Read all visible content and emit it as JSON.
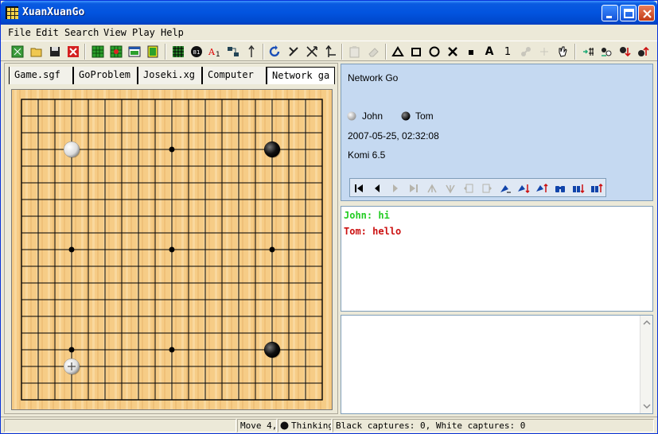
{
  "window": {
    "title": "XuanXuanGo"
  },
  "menu": [
    "File",
    "Edit",
    "Search",
    "View",
    "Play",
    "Help"
  ],
  "toolbar": {
    "icons": [
      "new-game-icon",
      "open-icon",
      "save-icon",
      "close-icon",
      "board-icon",
      "board-marks-icon",
      "board-window-icon",
      "board-green-icon",
      "grid-icon",
      "number-icon",
      "label-icon",
      "move-icon",
      "info-icon",
      "undo-arrow-icon",
      "strike-icon",
      "split-icon",
      "move-up-icon",
      "paste-icon",
      "erase-icon",
      "triangle-icon",
      "square-icon",
      "circle-icon",
      "cross-icon",
      "small-square-icon",
      "letter-a-icon",
      "number-1-icon",
      "link-icon",
      "plus-icon",
      "hand-icon",
      "markup-hash-icon",
      "stones-icon",
      "stone-down-icon",
      "stone-up-icon"
    ],
    "letter_label": "A",
    "number_label": "1"
  },
  "tabs": [
    "Game.sgf",
    "GoProblem",
    "Joseki.xg",
    "Computer",
    "Network ga"
  ],
  "board": {
    "size": 19,
    "hoshi": [
      [
        3,
        3
      ],
      [
        9,
        3
      ],
      [
        15,
        3
      ],
      [
        3,
        9
      ],
      [
        9,
        9
      ],
      [
        15,
        9
      ],
      [
        3,
        15
      ],
      [
        9,
        15
      ],
      [
        15,
        15
      ]
    ],
    "stones": [
      {
        "col": 3,
        "row": 3,
        "color": "white"
      },
      {
        "col": 15,
        "row": 3,
        "color": "black"
      },
      {
        "col": 15,
        "row": 15,
        "color": "black"
      },
      {
        "col": 3,
        "row": 16,
        "color": "white",
        "last": true
      }
    ]
  },
  "info": {
    "game_name": "Network Go",
    "white_player": "John",
    "black_player": "Tom",
    "datetime": "2007-05-25, 02:32:08",
    "komi": "Komi 6.5"
  },
  "chat": [
    {
      "text": "John: hi",
      "color": "#22cc22"
    },
    {
      "text": "Tom: hello",
      "color": "#cc1111"
    }
  ],
  "status": {
    "move": "Move 4,",
    "thinking": "Thinking",
    "captures": "Black captures: 0, White captures: 0"
  }
}
